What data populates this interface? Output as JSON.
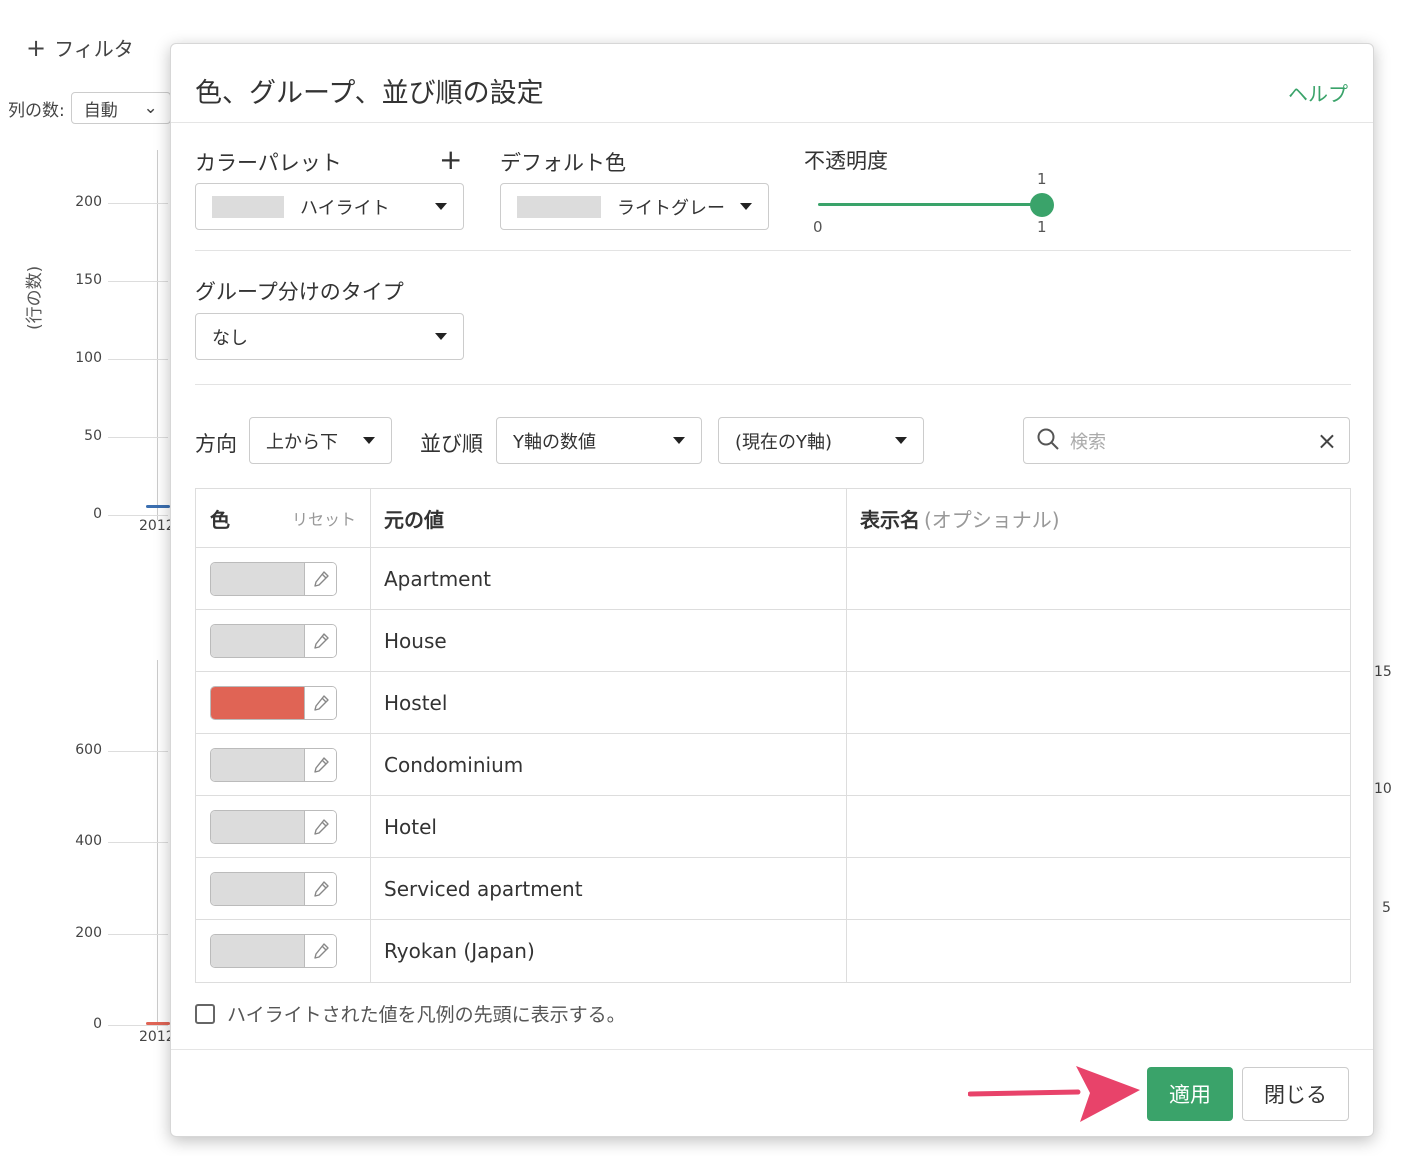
{
  "background": {
    "filter_label": "フィルタ",
    "cols_label": "列の数:",
    "cols_value": "自動",
    "y_axis_label": "(行の数)",
    "top_chart_ticks": [
      "200",
      "150",
      "100",
      "50",
      "0"
    ],
    "bottom_chart_ticks": [
      "600",
      "400",
      "200",
      "0"
    ],
    "year_label": "2012",
    "right_ticks": [
      "15",
      "10",
      "5"
    ]
  },
  "modal": {
    "title": "色、グループ、並び順の設定",
    "help_link": "ヘルプ",
    "color_palette": {
      "label": "カラーパレット",
      "add": "+",
      "value": "ハイライト"
    },
    "default_color": {
      "label": "デフォルト色",
      "value": "ライトグレー"
    },
    "opacity": {
      "label": "不透明度",
      "value": "1",
      "min": "0",
      "max": "1",
      "level": 1.0
    },
    "grouping": {
      "label": "グループ分けのタイプ",
      "value": "なし"
    },
    "direction": {
      "label": "方向",
      "value": "上から下"
    },
    "sort": {
      "label": "並び順",
      "value": "Y軸の数値",
      "secondary_value": "(現在のY軸)"
    },
    "search": {
      "placeholder": "検索"
    },
    "table": {
      "headers": {
        "color": "色",
        "reset": "リセット",
        "original": "元の値",
        "display_name": "表示名",
        "optional": "(オプショナル)"
      },
      "rows": [
        {
          "color": "#dcdcdc",
          "value": "Apartment",
          "display": ""
        },
        {
          "color": "#dcdcdc",
          "value": "House",
          "display": ""
        },
        {
          "color": "#e06455",
          "value": "Hostel",
          "display": ""
        },
        {
          "color": "#dcdcdc",
          "value": "Condominium",
          "display": ""
        },
        {
          "color": "#dcdcdc",
          "value": "Hotel",
          "display": ""
        },
        {
          "color": "#dcdcdc",
          "value": "Serviced apartment",
          "display": ""
        },
        {
          "color": "#dcdcdc",
          "value": "Ryokan (Japan)",
          "display": ""
        }
      ]
    },
    "checkbox_label": "ハイライトされた値を凡例の先頭に表示する。",
    "apply_button": "適用",
    "close_button": "閉じる"
  },
  "colors": {
    "accent": "#3aa36a",
    "arrow": "#e8436a",
    "highlight": "#e06455"
  }
}
